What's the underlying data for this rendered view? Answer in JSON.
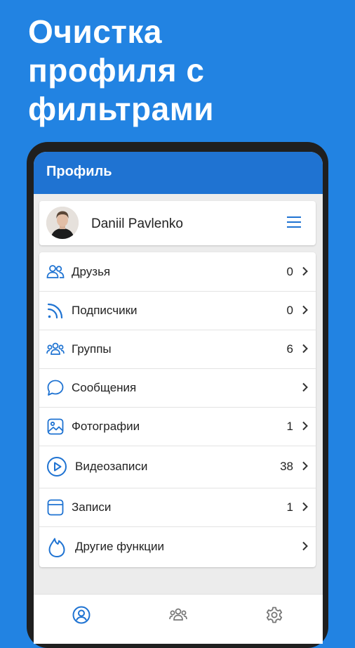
{
  "promo": {
    "headline_lines": [
      "Очистка",
      "профиля с",
      "фильтрами"
    ]
  },
  "appbar": {
    "title": "Профиль"
  },
  "profile": {
    "name": "Daniil Pavlenko",
    "menu_icon": "hamburger-menu-icon"
  },
  "menu": {
    "items": [
      {
        "label": "Друзья",
        "count": "0",
        "icon": "friends-icon"
      },
      {
        "label": "Подписчики",
        "count": "0",
        "icon": "rss-icon"
      },
      {
        "label": "Группы",
        "count": "6",
        "icon": "groups-icon"
      },
      {
        "label": "Сообщения",
        "count": "",
        "icon": "chat-bubble-icon"
      },
      {
        "label": "Фотографии",
        "count": "1",
        "icon": "image-icon"
      },
      {
        "label": "Видеозаписи",
        "count": "38",
        "icon": "play-circle-icon"
      },
      {
        "label": "Записи",
        "count": "1",
        "icon": "post-icon"
      },
      {
        "label": "Другие функции",
        "count": "",
        "icon": "flame-icon"
      }
    ]
  },
  "bottom_nav": {
    "items": [
      {
        "icon": "profile-icon",
        "active": true
      },
      {
        "icon": "groups-icon",
        "active": false
      },
      {
        "icon": "settings-icon",
        "active": false
      }
    ]
  },
  "colors": {
    "background": "#2283e2",
    "appbar": "#1f73d2",
    "accent": "#1f73d2",
    "inactive_icon": "#777777"
  }
}
